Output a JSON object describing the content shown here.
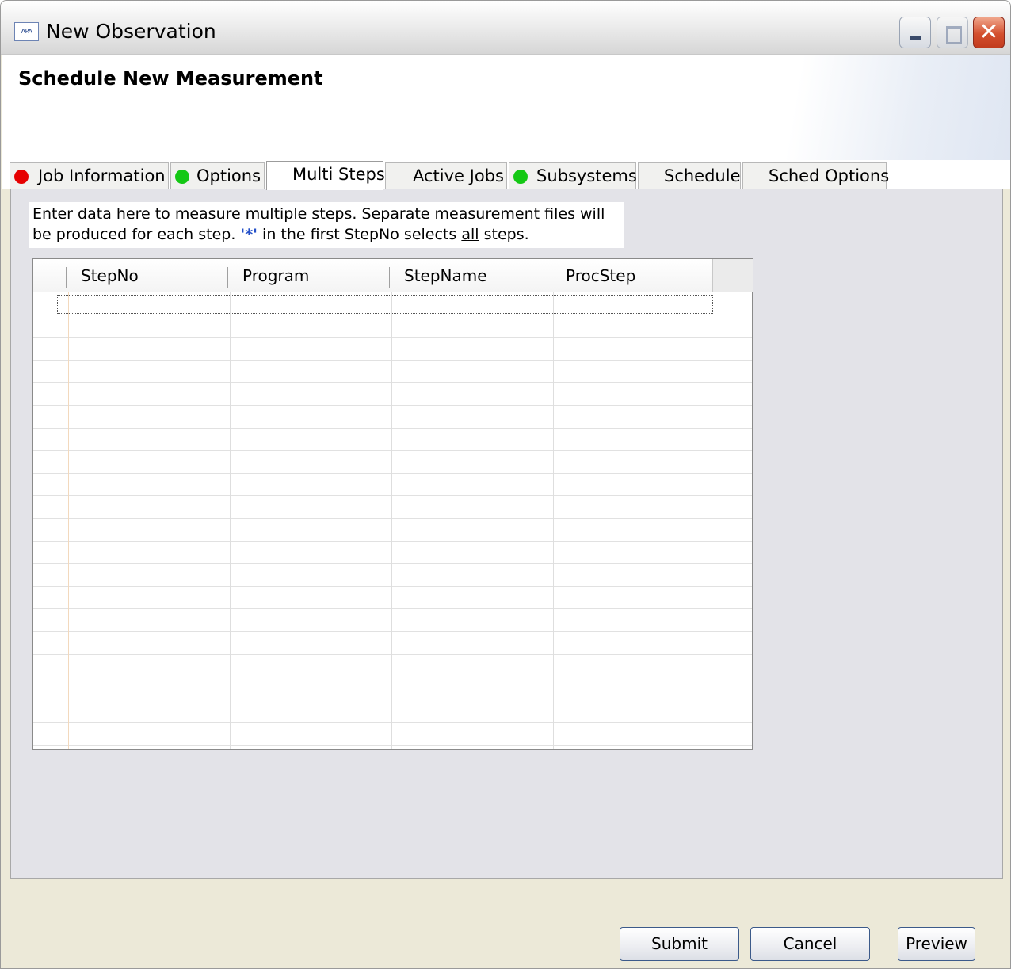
{
  "window": {
    "title": "New Observation",
    "icon_label": "APA",
    "close_glyph": "✕"
  },
  "header": {
    "title": "Schedule New Measurement"
  },
  "tabs": [
    {
      "label": "Job Information",
      "status": "red",
      "status_color": "#e60000"
    },
    {
      "label": "Options",
      "status": "green",
      "status_color": "#14c814"
    },
    {
      "label": "Multi Steps",
      "status": "",
      "active": true
    },
    {
      "label": "Active Jobs",
      "status": ""
    },
    {
      "label": "Subsystems",
      "status": "green",
      "status_color": "#14c814"
    },
    {
      "label": "Schedule",
      "status": ""
    },
    {
      "label": "Sched Options",
      "status": ""
    }
  ],
  "instructions": {
    "line1": "Enter data here to measure multiple steps. Separate measurement files will",
    "line2_before": "be produced for each step.",
    "star_token": "'*'",
    "line2_middle": "in the first StepNo selects",
    "underlined": "all",
    "line2_after": "steps."
  },
  "table": {
    "columns": [
      "StepNo",
      "Program",
      "StepName",
      "ProcStep"
    ],
    "row_count": 20
  },
  "buttons": {
    "submit": "Submit",
    "cancel": "Cancel",
    "preview": "Preview"
  }
}
